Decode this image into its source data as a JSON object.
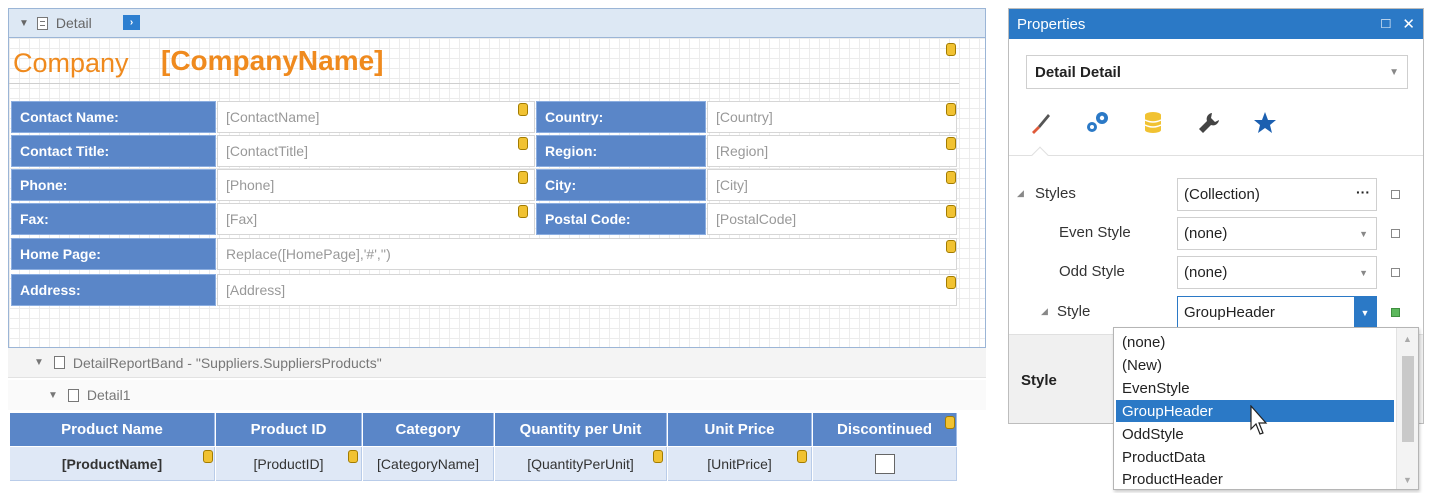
{
  "designer": {
    "detail_band": {
      "title": "Detail"
    },
    "company": {
      "label": "Company",
      "value": "[CompanyName]"
    },
    "contact_rows": [
      {
        "label": "Contact Name:",
        "value": "[ContactName]"
      },
      {
        "label": "Contact Title:",
        "value": "[ContactTitle]"
      },
      {
        "label": "Phone:",
        "value": "[Phone]"
      },
      {
        "label": "Fax:",
        "value": "[Fax]"
      },
      {
        "label": "Home Page:",
        "value": "Replace([HomePage],'#','')"
      },
      {
        "label": "Address:",
        "value": "[Address]"
      }
    ],
    "location_rows": [
      {
        "label": "Country:",
        "value": "[Country]"
      },
      {
        "label": "Region:",
        "value": "[Region]"
      },
      {
        "label": "City:",
        "value": "[City]"
      },
      {
        "label": "Postal Code:",
        "value": "[PostalCode]"
      }
    ],
    "detail_report_band": {
      "title": "DetailReportBand - \"Suppliers.SuppliersProducts\""
    },
    "detail1_band": {
      "title": "Detail1"
    },
    "products_table": {
      "headers": [
        "Product Name",
        "Product ID",
        "Category",
        "Quantity per Unit",
        "Unit Price",
        "Discontinued"
      ],
      "cells": [
        "[ProductName]",
        "[ProductID]",
        "[CategoryName]",
        "[QuantityPerUnit]",
        "[UnitPrice]",
        ""
      ]
    }
  },
  "properties": {
    "title": "Properties",
    "selected_object": {
      "name": "Detail",
      "type": "Detail"
    },
    "tab_icons": [
      "brush-icon",
      "gears-icon",
      "database-icon",
      "wrench-icon",
      "star-icon"
    ],
    "rows": {
      "styles": {
        "name": "Styles",
        "value": "(Collection)"
      },
      "even_style": {
        "name": "Even Style",
        "value": "(none)"
      },
      "odd_style": {
        "name": "Odd Style",
        "value": "(none)"
      },
      "style": {
        "name": "Style",
        "value": "GroupHeader"
      }
    },
    "bottom_label": "Style",
    "style_options": [
      "(none)",
      "(New)",
      "EvenStyle",
      "GroupHeader",
      "OddStyle",
      "ProductData",
      "ProductHeader"
    ],
    "selected_option": "GroupHeader"
  },
  "colors": {
    "accent": "#2b79c6",
    "label_cell": "#5a86c8",
    "company_text": "#ef8a1e"
  }
}
